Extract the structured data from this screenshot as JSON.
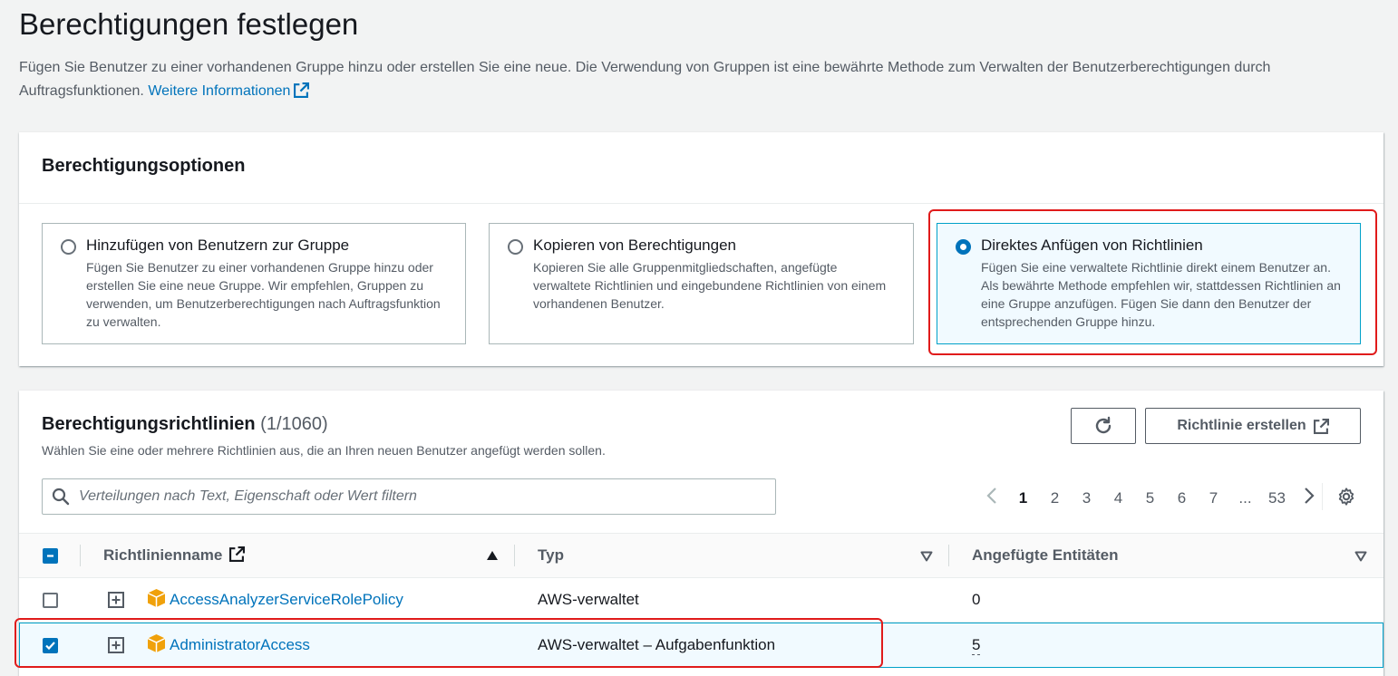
{
  "page": {
    "title": "Berechtigungen festlegen",
    "description": "Fügen Sie Benutzer zu einer vorhandenen Gruppe hinzu oder erstellen Sie eine neue. Die Verwendung von Gruppen ist eine bewährte Methode zum Verwalten der Benutzerberechtigungen durch Auftragsfunktionen.",
    "learn_more": "Weitere Informationen"
  },
  "options_panel": {
    "title": "Berechtigungsoptionen",
    "options": [
      {
        "title": "Hinzufügen von Benutzern zur Gruppe",
        "description": "Fügen Sie Benutzer zu einer vorhandenen Gruppe hinzu oder erstellen Sie eine neue Gruppe. Wir empfehlen, Gruppen zu verwenden, um Benutzerberechtigungen nach Auftragsfunktion zu verwalten.",
        "selected": false
      },
      {
        "title": "Kopieren von Berechtigungen",
        "description": "Kopieren Sie alle Gruppenmitgliedschaften, angefügte verwaltete Richtlinien und eingebundene Richtlinien von einem vorhandenen Benutzer.",
        "selected": false
      },
      {
        "title": "Direktes Anfügen von Richtlinien",
        "description": "Fügen Sie eine verwaltete Richtlinie direkt einem Benutzer an. Als bewährte Methode empfehlen wir, stattdessen Richtlinien an eine Gruppe anzufügen. Fügen Sie dann den Benutzer der entsprechenden Gruppe hinzu.",
        "selected": true
      }
    ]
  },
  "policies_panel": {
    "title": "Berechtigungsrichtlinien",
    "count": "(1/1060)",
    "subtitle": "Wählen Sie eine oder mehrere Richtlinien aus, die an Ihren neuen Benutzer angefügt werden sollen.",
    "create_button": "Richtlinie erstellen",
    "search_placeholder": "Verteilungen nach Text, Eigenschaft oder Wert filtern",
    "pagination": {
      "pages": [
        "1",
        "2",
        "3",
        "4",
        "5",
        "6",
        "7",
        "...",
        "53"
      ],
      "current": "1"
    },
    "columns": {
      "name": "Richtlinienname",
      "type": "Typ",
      "entities": "Angefügte Entitäten"
    },
    "rows": [
      {
        "name": "AccessAnalyzerServiceRolePolicy",
        "type": "AWS-verwaltet",
        "entities": "0",
        "checked": false
      },
      {
        "name": "AdministratorAccess",
        "type": "AWS-verwaltet – Aufgabenfunktion",
        "entities": "5",
        "checked": true
      }
    ]
  },
  "colors": {
    "link": "#0073bb",
    "selected_border": "#00a1c9",
    "selected_bg": "#f1faff",
    "highlight": "#e01b1b",
    "package_icon": "#f0a10b"
  },
  "icons": [
    "external-link-icon",
    "refresh-icon",
    "search-icon",
    "chevron-left-icon",
    "chevron-right-icon",
    "settings-gear-icon",
    "sort-ascending-icon",
    "sort-descending-icon",
    "expand-plus-icon",
    "aws-package-icon"
  ]
}
